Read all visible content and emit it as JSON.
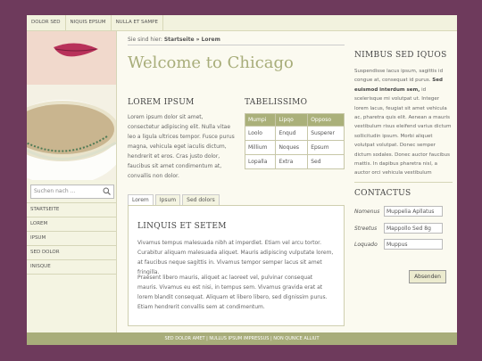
{
  "topnav": [
    "DOLOR SED",
    "NIQUIS EPSUM",
    "NULLA ET SAMPE"
  ],
  "search": {
    "placeholder": "Suchen nach ..."
  },
  "leftnav": [
    "STARTSEITE",
    "LOREM",
    "IPSUM",
    "SED DOLOR",
    "INISQUE"
  ],
  "breadcrumb": {
    "prefix": "Sie sind hier: ",
    "path": "Startseite » Lorem"
  },
  "title": "Welcome to Chicago",
  "col1": {
    "heading": "LOREM IPSUM",
    "text": "Lorem ipsum dolor sit amet, consectetur adipiscing elit. Nulla vitae leo a ligula ultrices tempor. Fusce purus magna, vehicula eget iaculis dictum, hendrerit et eros. Cras justo dolor, faucibus sit amet condimentum at, convallis non dolor."
  },
  "table": {
    "heading": "TABELISSIMO",
    "headers": [
      "Mumpi",
      "Lipqo",
      "Opposo"
    ],
    "rows": [
      [
        "Loolo",
        "Enqud",
        "Susperer"
      ],
      [
        "Millium",
        "Noques",
        "Epsum"
      ],
      [
        "Lopalla",
        "Extra",
        "Sed"
      ]
    ]
  },
  "tabs": [
    "Lorem",
    "Ipsum",
    "Sed dolors"
  ],
  "tabcontent": {
    "heading": "LINQUIS ET SETEM",
    "p1": "Vivamus tempus malesuada nibh at imperdiet. Etiam vel arcu tortor. Curabitur aliquam malesuada aliquet. Mauris adipiscing vulputate lorem, at faucibus neque sagittis in. Vivamus tempor semper lacus sit amet fringilla.",
    "p2": "Praesent libero mauris, aliquet ac laoreet vel, pulvinar consequat mauris. Vivamus eu est nisi, in tempus sem. Vivamus gravida erat at lorem blandit consequat. Aliquam et libero libero, sed dignissim purus. Etiam hendrerit convallis sem at condimentum."
  },
  "sidebar": {
    "heading": "NIMBUS SED IQUOS",
    "text_a": "Suspendisse lacus ipsum, sagittis id congue at, consequat id purus. ",
    "text_bold": "Sed euismod interdum sem,",
    "text_b": " id scelerisque mi volutpat ut. Integer lorem lacus, feugiat sit amet vehicula ac, pharetra quis elit. Aenean a mauris vestibulum risus eleifend varius dictum sollicitudin ipsum. Morbi aliquet volutpat volutpat. Donec semper dictum sodales. Donec auctor faucibus mattis. In dapibus pharetra nisl, a auctor orci vehicula vestibulum"
  },
  "contact": {
    "heading": "CONTACTUS",
    "fields": [
      {
        "label": "Nomenus",
        "value": "Muppelia Apllatus"
      },
      {
        "label": "Streetus",
        "value": "Mappollo Sed 8g"
      },
      {
        "label": "Loquado",
        "value": "Muppus"
      }
    ],
    "submit": "Absenden"
  },
  "footer": "SED DOLOR AMET | NULLUS IPSUM IMPRESSUS | NON QUNICE ALLIUT"
}
